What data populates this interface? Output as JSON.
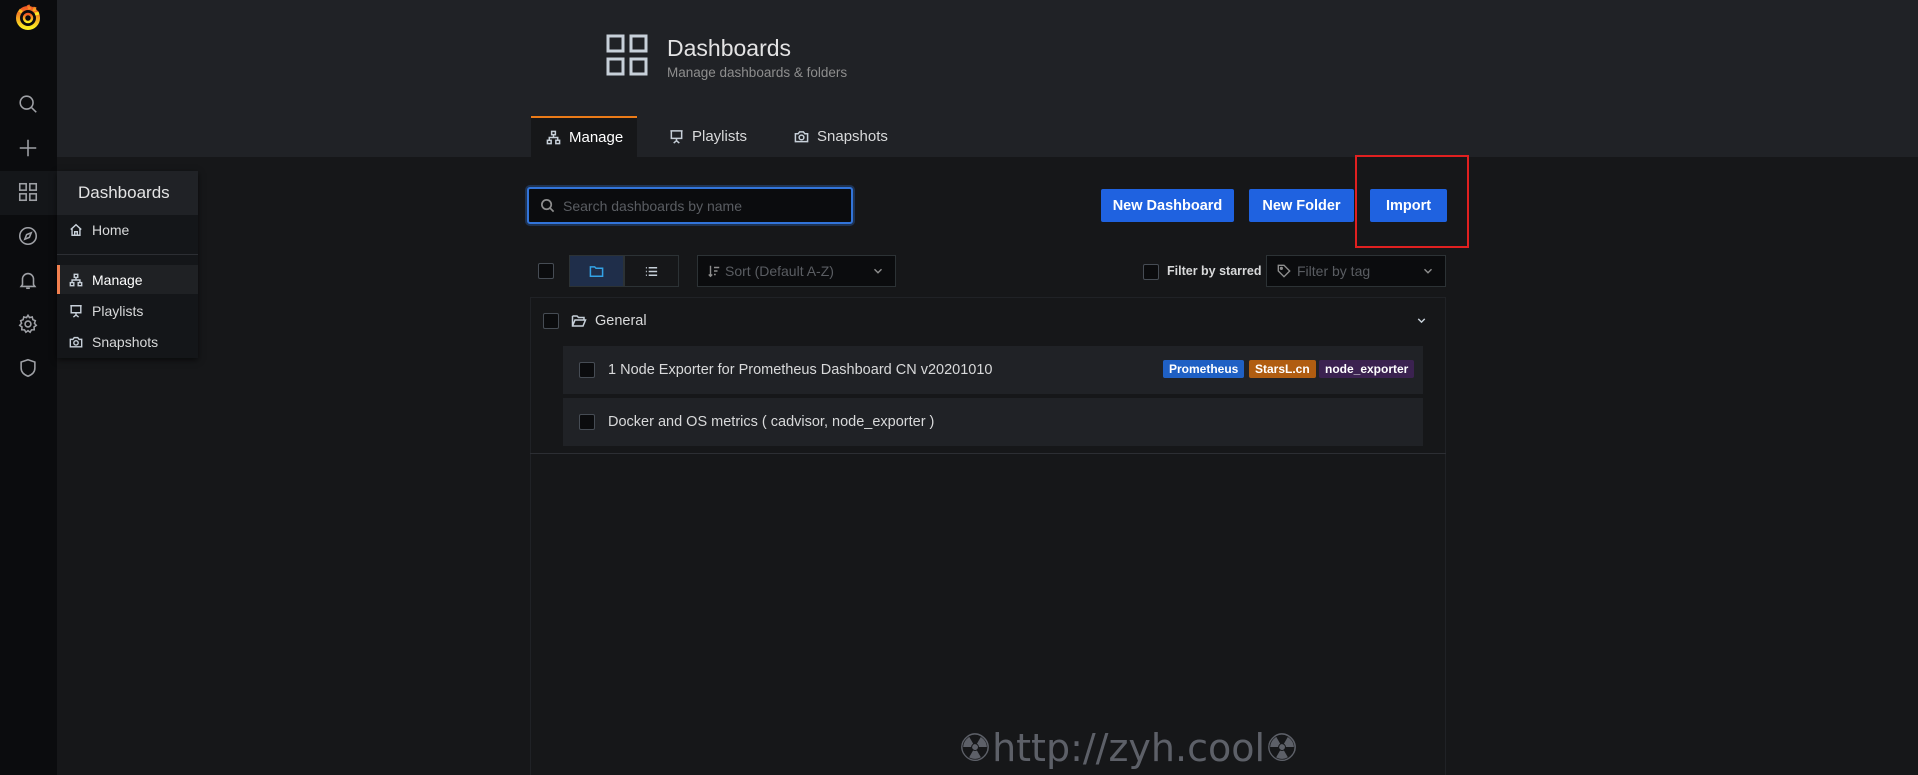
{
  "header": {
    "title": "Dashboards",
    "subtitle": "Manage dashboards & folders"
  },
  "tabs": [
    {
      "label": "Manage",
      "icon": "sitemap-icon",
      "active": true
    },
    {
      "label": "Playlists",
      "icon": "presentation-icon",
      "active": false
    },
    {
      "label": "Snapshots",
      "icon": "camera-icon",
      "active": false
    }
  ],
  "sidemenu": {
    "icons": [
      "grafana-logo",
      "search-icon",
      "plus-icon",
      "apps-icon",
      "compass-icon",
      "bell-icon",
      "gear-icon",
      "shield-icon"
    ]
  },
  "submenu": {
    "title": "Dashboards",
    "items": [
      {
        "label": "Home",
        "icon": "home-icon",
        "active": false
      },
      {
        "label": "Manage",
        "icon": "sitemap-icon",
        "active": true
      },
      {
        "label": "Playlists",
        "icon": "presentation-icon",
        "active": false
      },
      {
        "label": "Snapshots",
        "icon": "camera-icon",
        "active": false
      }
    ]
  },
  "search": {
    "placeholder": "Search dashboards by name",
    "value": ""
  },
  "actions": {
    "new_dashboard": "New Dashboard",
    "new_folder": "New Folder",
    "import": "Import"
  },
  "filters": {
    "sort_placeholder": "Sort (Default A-Z)",
    "starred_label": "Filter by starred",
    "tag_placeholder": "Filter by tag"
  },
  "folder": {
    "name": "General",
    "dashboards": [
      {
        "title": "1 Node Exporter for Prometheus Dashboard CN v20201010",
        "tags": [
          {
            "label": "Prometheus",
            "color": "#1f60c4"
          },
          {
            "label": "StarsL.cn",
            "color": "#b05d11"
          },
          {
            "label": "node_exporter",
            "color": "#3b2250"
          }
        ]
      },
      {
        "title": "Docker and OS metrics ( cadvisor, node_exporter )",
        "tags": []
      }
    ]
  },
  "watermark": "☢http://zyh.cool☢",
  "colors": {
    "accent_orange": "#eb7b18",
    "primary_button": "#1f62e0",
    "highlight_red": "#e02020"
  }
}
